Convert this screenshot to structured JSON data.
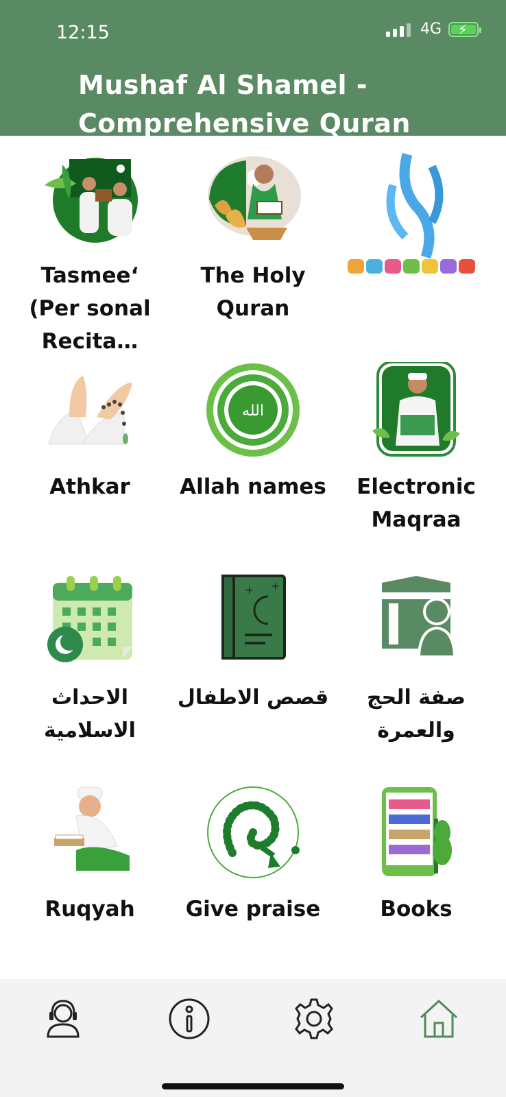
{
  "status": {
    "time": "12:15",
    "network": "4G"
  },
  "header": {
    "title": "Mushaf Al Shamel - Comprehensive Quran"
  },
  "grid": {
    "items": [
      {
        "label": "Tasmee‘ (Per sonal Recita…",
        "icon": "recitation-icon"
      },
      {
        "label": "The Holy Quran",
        "icon": "holy-quran-icon"
      },
      {
        "label": "",
        "icon": "shamel-kids-logo"
      },
      {
        "label": "Athkar",
        "icon": "praying-hands-icon"
      },
      {
        "label": "Allah names",
        "icon": "allah-names-icon"
      },
      {
        "label": "Electronic Maqraa",
        "icon": "maqraa-icon"
      },
      {
        "label": "الاحداث الاسلامية",
        "icon": "calendar-icon"
      },
      {
        "label": "قصص الاطفال",
        "icon": "kids-stories-book-icon"
      },
      {
        "label": "صفة الحج والعمرة",
        "icon": "kaaba-pilgrim-icon"
      },
      {
        "label": "Ruqyah",
        "icon": "ruqyah-reader-icon"
      },
      {
        "label": "Give praise",
        "icon": "prayer-beads-icon"
      },
      {
        "label": "Books",
        "icon": "books-shelf-icon"
      }
    ]
  },
  "tabbar": {
    "tabs": [
      {
        "icon": "support-agent-icon"
      },
      {
        "icon": "info-icon"
      },
      {
        "icon": "settings-icon"
      },
      {
        "icon": "home-icon",
        "active": true
      }
    ]
  },
  "colors": {
    "header": "#5a8a63",
    "accent": "#4f8a58",
    "tabbar": "#f3f3f3"
  }
}
